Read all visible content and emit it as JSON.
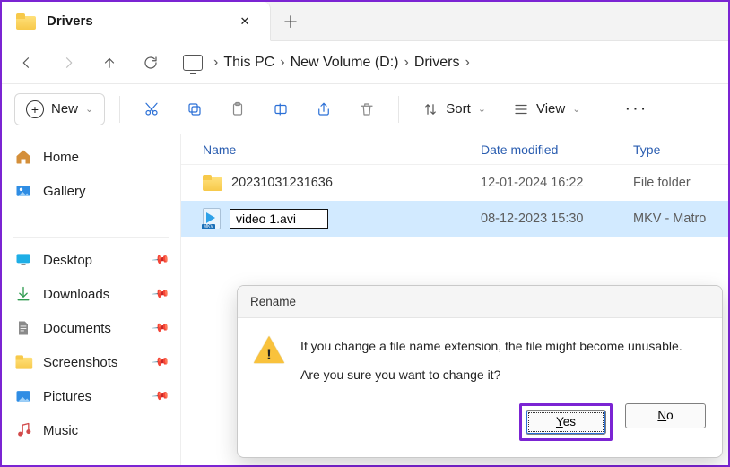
{
  "tab": {
    "title": "Drivers"
  },
  "breadcrumb": {
    "root": "This PC",
    "vol": "New Volume (D:)",
    "folder": "Drivers"
  },
  "toolbar": {
    "new": "New",
    "sort": "Sort",
    "view": "View"
  },
  "columns": {
    "name": "Name",
    "date": "Date modified",
    "type": "Type"
  },
  "sidebar": {
    "home": "Home",
    "gallery": "Gallery",
    "desktop": "Desktop",
    "downloads": "Downloads",
    "documents": "Documents",
    "screenshots": "Screenshots",
    "pictures": "Pictures",
    "music": "Music"
  },
  "rows": [
    {
      "name": "20231031231636",
      "date": "12-01-2024 16:22",
      "type": "File folder"
    },
    {
      "name": "video 1.avi",
      "date": "08-12-2023 15:30",
      "type": "MKV - Matro"
    }
  ],
  "dialog": {
    "title": "Rename",
    "line1": "If you change a file name extension, the file might become unusable.",
    "line2": "Are you sure you want to change it?",
    "yes": "Yes",
    "no": "No"
  }
}
